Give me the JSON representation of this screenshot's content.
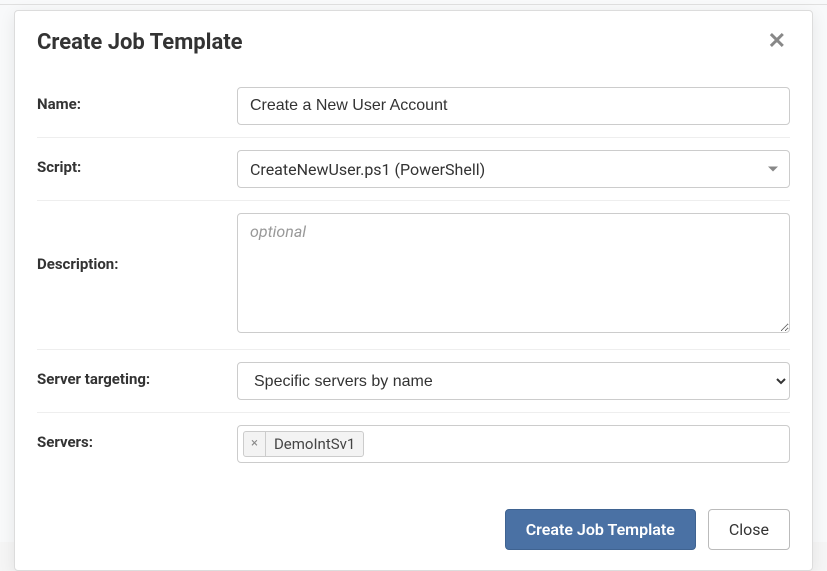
{
  "modal": {
    "title": "Create Job Template"
  },
  "form": {
    "name": {
      "label": "Name:",
      "value": "Create a New User Account"
    },
    "script": {
      "label": "Script:",
      "selected": "CreateNewUser.ps1 (PowerShell)"
    },
    "description": {
      "label": "Description:",
      "placeholder": "optional",
      "value": ""
    },
    "server_targeting": {
      "label": "Server targeting:",
      "selected": "Specific servers by name"
    },
    "servers": {
      "label": "Servers:",
      "tags": [
        {
          "label": "DemoIntSv1"
        }
      ]
    }
  },
  "footer": {
    "primary": "Create Job Template",
    "secondary": "Close"
  }
}
